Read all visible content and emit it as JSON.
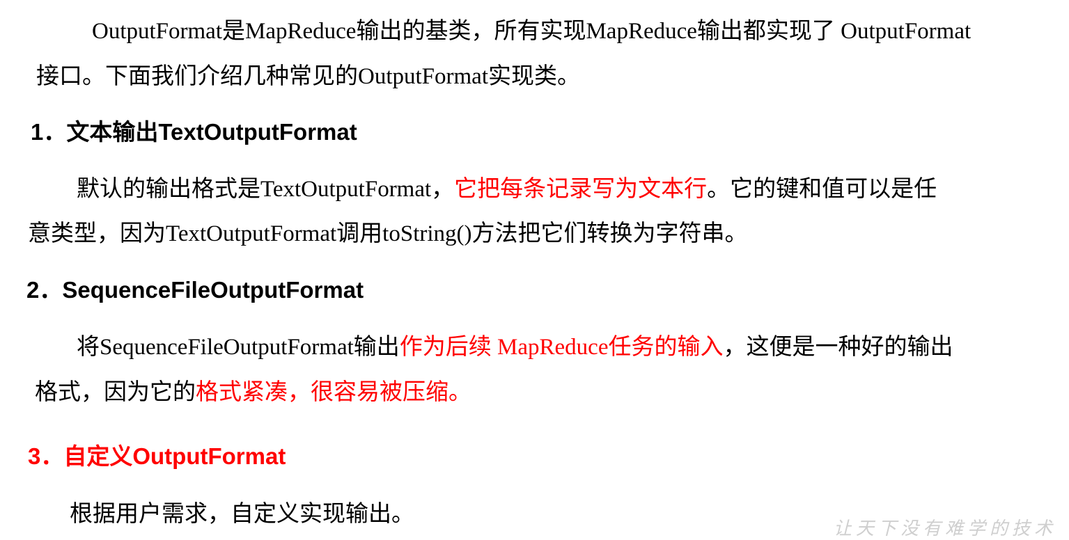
{
  "intro": {
    "line1": {
      "a": "OutputFormat",
      "b": "是",
      "c": "MapReduce",
      "d": "输出的基类，所有实现",
      "e": "MapReduce",
      "f": "输出都实现了",
      "g": " OutputFormat"
    },
    "line2": {
      "a": "接口。下面我们介绍几种常见的",
      "b": "OutputFormat",
      "c": "实现类。"
    }
  },
  "sections": [
    {
      "heading": "1．文本输出TextOutputFormat",
      "line1": {
        "a": "默认的输出格式是",
        "b": "TextOutputFormat",
        "c": "，",
        "d": "它把每条记录写为文本行",
        "e": "。它的键和值可以是任"
      },
      "line2": {
        "a": "意类型，因为",
        "b": "TextOutputFormat",
        "c": "调用",
        "d": "toString()",
        "e": "方法把它们转换为字符串。"
      }
    },
    {
      "heading": "2．SequenceFileOutputFormat",
      "line1": {
        "a": "将",
        "b": "SequenceFileOutputFormat",
        "c": "输出",
        "d": "作为后续",
        "e": " MapReduce",
        "f": "任务的输入",
        "g": "，这便是一种好的输出"
      },
      "line2": {
        "a": "格式，因为它的",
        "b": "格式紧凑，很容易被压缩。"
      }
    },
    {
      "heading": "3．自定义OutputFormat",
      "line1": {
        "a": "根据用户需求，自定义实现输出。"
      }
    }
  ],
  "watermark": "让天下没有难学的技术",
  "colors": {
    "text": "#000000",
    "highlight": "#ff0000",
    "watermark": "#cfcfcf"
  }
}
